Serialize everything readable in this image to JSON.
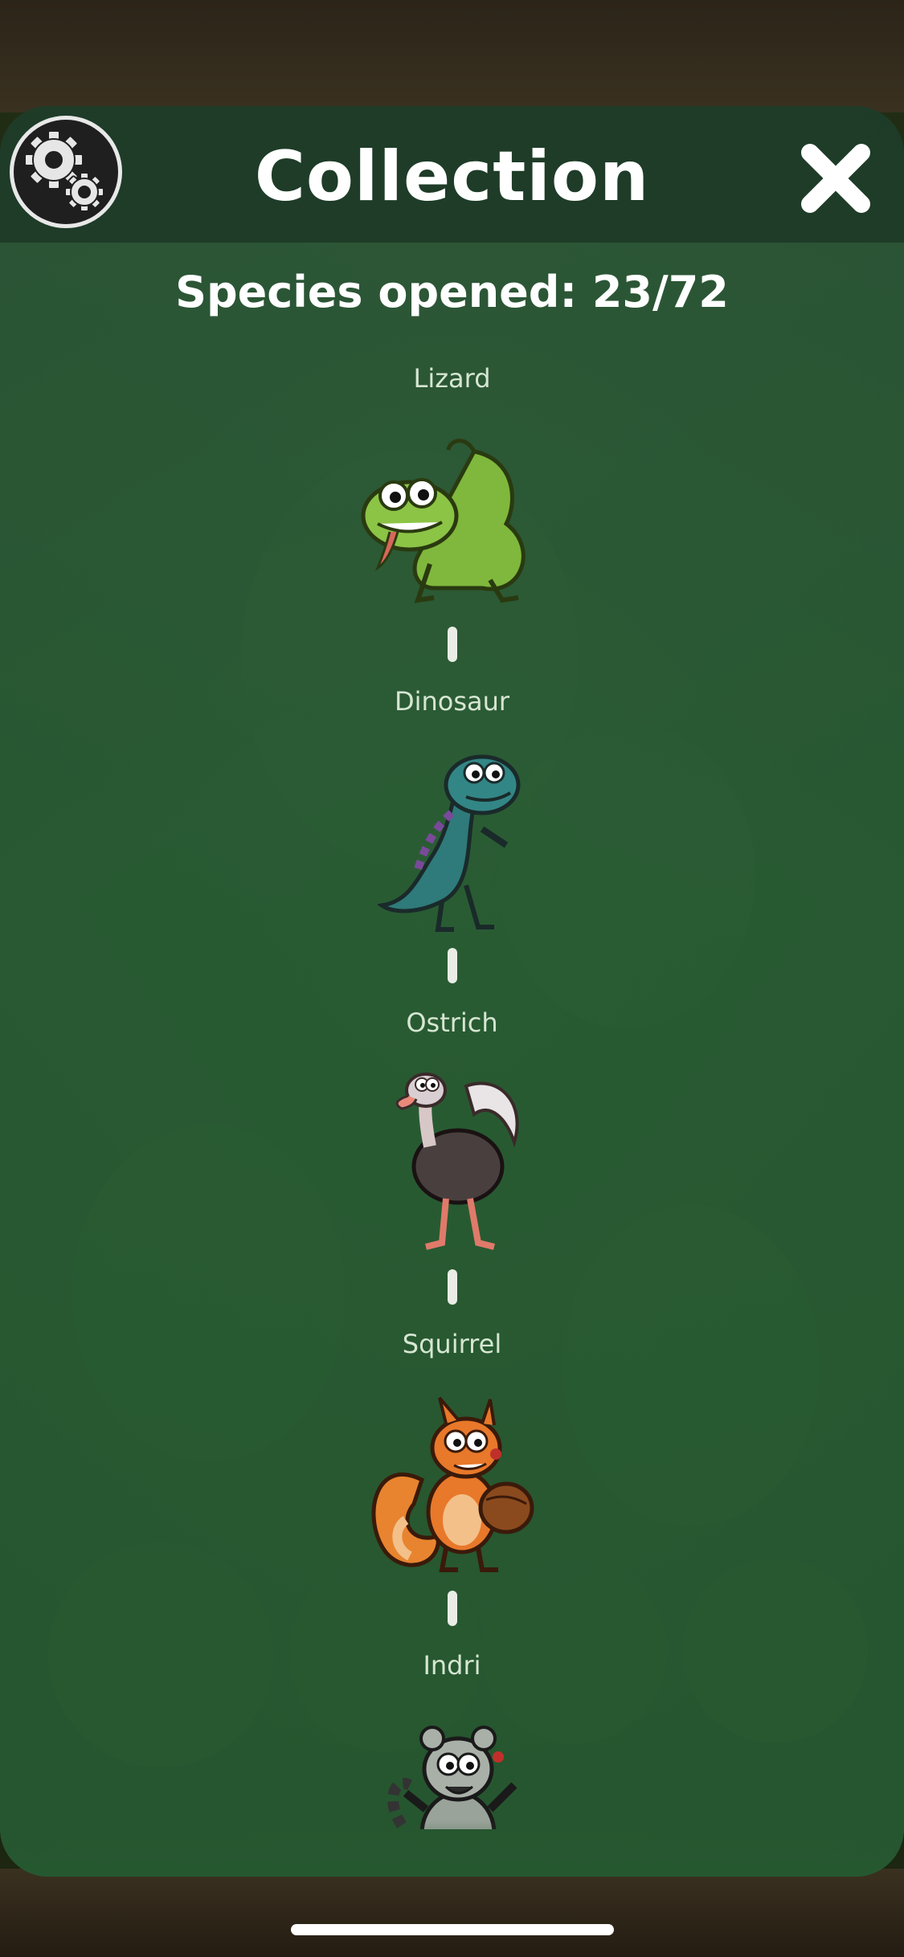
{
  "header": {
    "title": "Collection",
    "settings_icon": "gears-icon",
    "close_icon": "close-icon"
  },
  "summary": {
    "species_label": "Species opened: 23/72"
  },
  "collection": {
    "items": [
      {
        "name": "Lizard",
        "icon": "lizard-icon"
      },
      {
        "name": "Dinosaur",
        "icon": "dinosaur-icon"
      },
      {
        "name": "Ostrich",
        "icon": "ostrich-icon"
      },
      {
        "name": "Squirrel",
        "icon": "squirrel-icon"
      },
      {
        "name": "Indri",
        "icon": "indri-icon"
      }
    ]
  },
  "colors": {
    "panel": "#2c5838",
    "title_text": "#ffffff",
    "item_name_text": "#d6e6d2",
    "connector": "#e9ede6"
  }
}
